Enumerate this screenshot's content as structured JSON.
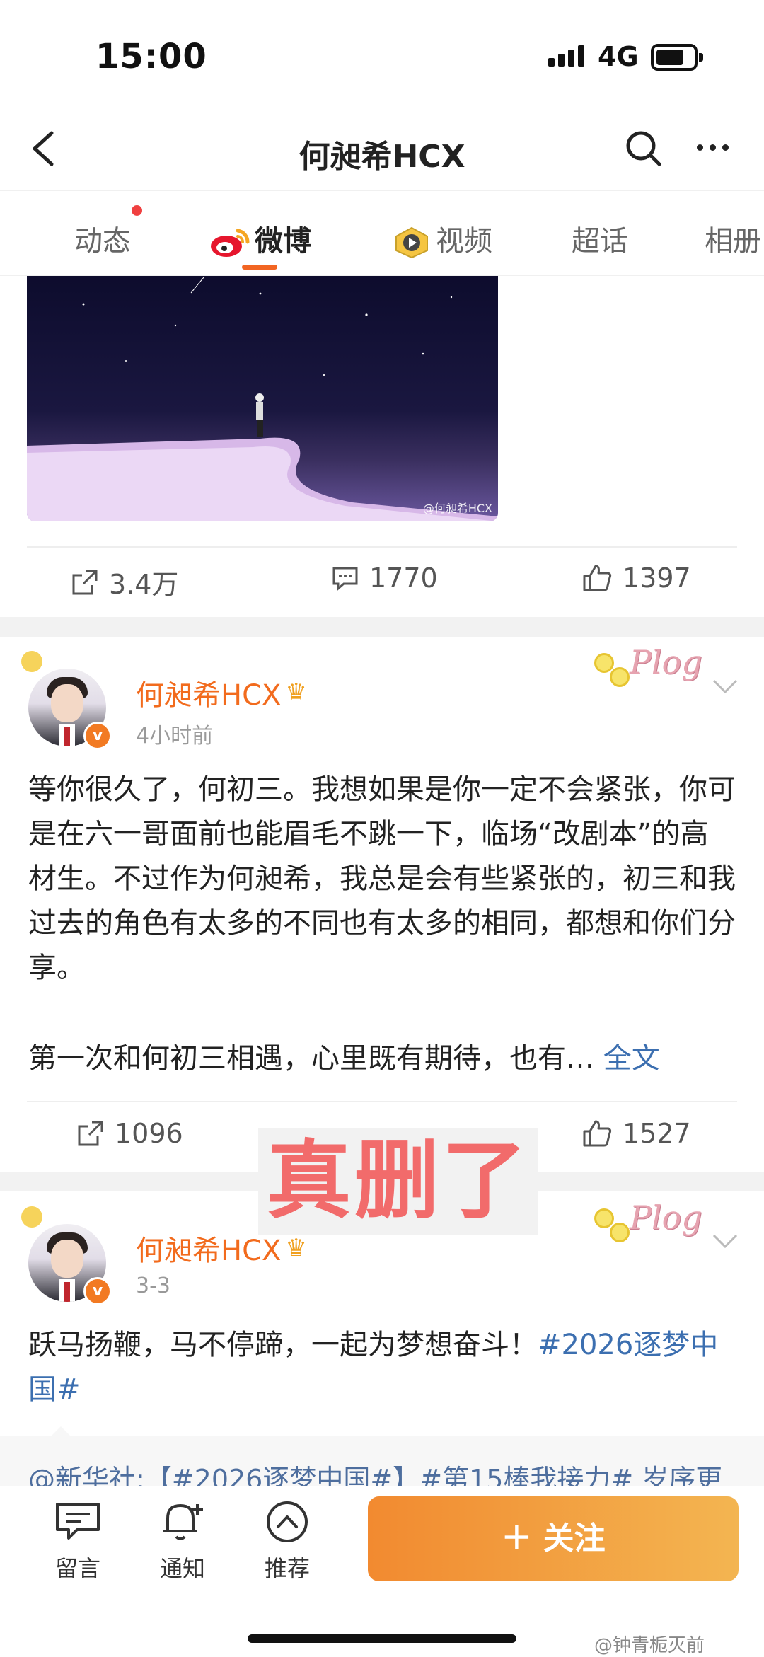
{
  "status": {
    "time": "15:00",
    "network": "4G"
  },
  "header": {
    "title": "何昶希HCX"
  },
  "tabs": [
    {
      "label": "动态"
    },
    {
      "label": "微博"
    },
    {
      "label": "视频"
    },
    {
      "label": "超话"
    },
    {
      "label": "相册"
    }
  ],
  "prev_post": {
    "image_watermark": "@何昶希HCX",
    "reposts": "3.4万",
    "comments": "1770",
    "likes": "1397"
  },
  "post1": {
    "username": "何昶希HCX",
    "time": "4小时前",
    "badge": "Plog",
    "paragraph1": "等你很久了，何初三。我想如果是你一定不会紧张，你可是在六一哥面前也能眉毛不跳一下，临场“改剧本”的高材生。不过作为何昶希，我总是会有些紧张的，初三和我过去的角色有太多的不同也有太多的相同，都想和你们分享。",
    "paragraph2": "第一次和何初三相遇，心里既有期待，也有…",
    "full_text_link": "全文",
    "reposts": "1096",
    "likes": "1527"
  },
  "overlay": {
    "text": "真删了"
  },
  "post2": {
    "username": "何昶希HCX",
    "time": "3-3",
    "badge": "Plog",
    "content": "跃马扬鞭，马不停蹄，一起为梦想奋斗！",
    "hashtag": "#2026逐梦中国#",
    "repost_preview": "@新华社:【#2026逐梦中国#】#第15棒我接力# 岁序更"
  },
  "bottom_bar": {
    "message_label": "留言",
    "notify_label": "通知",
    "recommend_label": "推荐",
    "follow_label": "＋ 关注"
  },
  "footer_watermark": "@钟青栀灭前",
  "colors": {
    "accent": "#f26b1d",
    "link": "#3c6fb0",
    "follow_gradient_start": "#f28a30",
    "follow_gradient_end": "#f3b551"
  }
}
